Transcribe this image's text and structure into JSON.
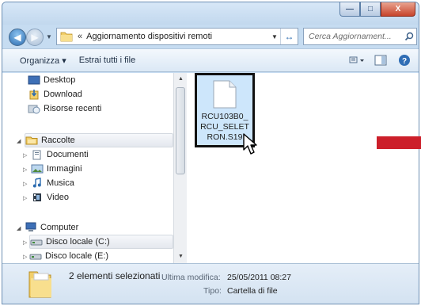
{
  "window": {
    "caption_buttons": [
      "minimize",
      "maximize",
      "close"
    ],
    "close_glyph": "X",
    "min_glyph": "—",
    "max_glyph": "□"
  },
  "navigation": {
    "back_icon": "back-arrow-icon",
    "forward_icon": "forward-arrow-icon"
  },
  "address_bar": {
    "breadcrumb_separator": "«",
    "path": "Aggiornamento dispositivi remoti"
  },
  "search": {
    "placeholder": "Cerca Aggiornament..."
  },
  "toolbar": {
    "organize_label": "Organizza ▾",
    "extract_label": "Estrai tutti i file"
  },
  "nav_pane": {
    "favorites": [
      {
        "label": "Desktop",
        "icon": "desktop-icon"
      },
      {
        "label": "Download",
        "icon": "download-folder-icon"
      },
      {
        "label": "Risorse recenti",
        "icon": "recent-places-icon"
      }
    ],
    "libraries": {
      "label": "Raccolte",
      "items": [
        {
          "label": "Documenti",
          "icon": "documents-icon"
        },
        {
          "label": "Immagini",
          "icon": "pictures-icon"
        },
        {
          "label": "Musica",
          "icon": "music-icon"
        },
        {
          "label": "Video",
          "icon": "video-icon"
        }
      ]
    },
    "computer": {
      "label": "Computer",
      "items": [
        {
          "label": "Disco locale (C:)",
          "icon": "local-disk-icon"
        },
        {
          "label": "Disco locale (E:)",
          "icon": "local-disk-icon"
        }
      ]
    }
  },
  "content": {
    "file": {
      "name_lines": [
        "RCU103B0_",
        "RCU_SELET",
        "RON.S19"
      ]
    }
  },
  "details": {
    "title": "2 elementi selezionati",
    "modified_label": "Ultima modifica:",
    "modified_value": "25/05/2011 08:27",
    "type_label": "Tipo:",
    "type_value": "Cartella di file"
  },
  "colors": {
    "accent_red": "#cc1f2a",
    "selection_blue": "#cde6fb",
    "chrome_blue": "#c6dcf1"
  }
}
